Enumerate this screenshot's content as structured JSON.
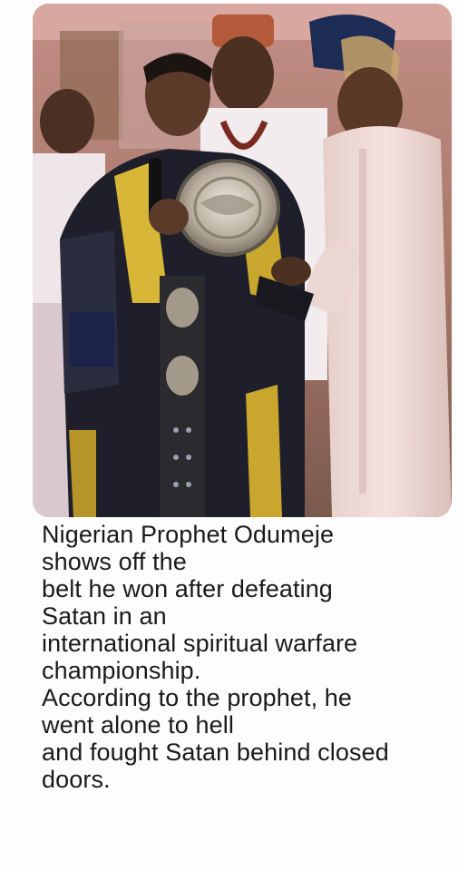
{
  "post": {
    "caption_lines": [
      "Nigerian  Prophet Odumeje",
      "shows off the",
      "belt he won after defeating",
      "Satan in an",
      "international spiritual warfare",
      "championship.",
      "According to the prophet, he",
      "went alone to hell",
      "and fought Satan behind closed",
      "doors."
    ]
  },
  "photo": {
    "subject": "man in black and yellow robe holding a championship belt and microphone",
    "colors": {
      "background_wall": "#b98a7a",
      "robe_black": "#1e1f2b",
      "robe_yellow": "#d8b637",
      "white_outfit": "#f1e7e4",
      "pink_outfit": "#ecd7d3",
      "skin": "#5b3a2a",
      "belt_gold": "#c8c0b4"
    }
  }
}
